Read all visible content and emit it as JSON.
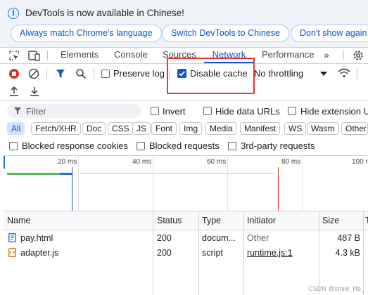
{
  "infobar": {
    "message": "DevTools is now available in Chinese!",
    "btn_match": "Always match Chrome's language",
    "btn_switch": "Switch DevTools to Chinese",
    "btn_dont": "Don't show again"
  },
  "tabs": [
    "Elements",
    "Console",
    "Sources",
    "Network",
    "Performance"
  ],
  "toolbar": {
    "preserve_log": "Preserve log",
    "disable_cache": "Disable cache",
    "throttling": "No throttling"
  },
  "filter": {
    "placeholder": "Filter",
    "invert": "Invert",
    "hide_data_urls": "Hide data URLs",
    "hide_extension": "Hide extension U"
  },
  "chips": [
    "All",
    "Fetch/XHR",
    "Doc",
    "CSS",
    "JS",
    "Font",
    "Img",
    "Media",
    "Manifest",
    "WS",
    "Wasm",
    "Other"
  ],
  "blocked": {
    "cookies": "Blocked response cookies",
    "requests": "Blocked requests",
    "third_party": "3rd-party requests"
  },
  "timeline": {
    "ticks": [
      "20 ms",
      "40 ms",
      "60 ms",
      "80 ms",
      "100 r"
    ]
  },
  "table": {
    "headers": [
      "Name",
      "Status",
      "Type",
      "Initiator",
      "Size",
      "T"
    ],
    "rows": [
      {
        "name": "pay.html",
        "status": "200",
        "type": "docum...",
        "initiator": "Other",
        "size": "487 B"
      },
      {
        "name": "adapter.js",
        "status": "200",
        "type": "script",
        "initiator": "runtime.js:1",
        "size": "4.3 kB"
      }
    ]
  },
  "watermark": "CSDN @smile_life_"
}
